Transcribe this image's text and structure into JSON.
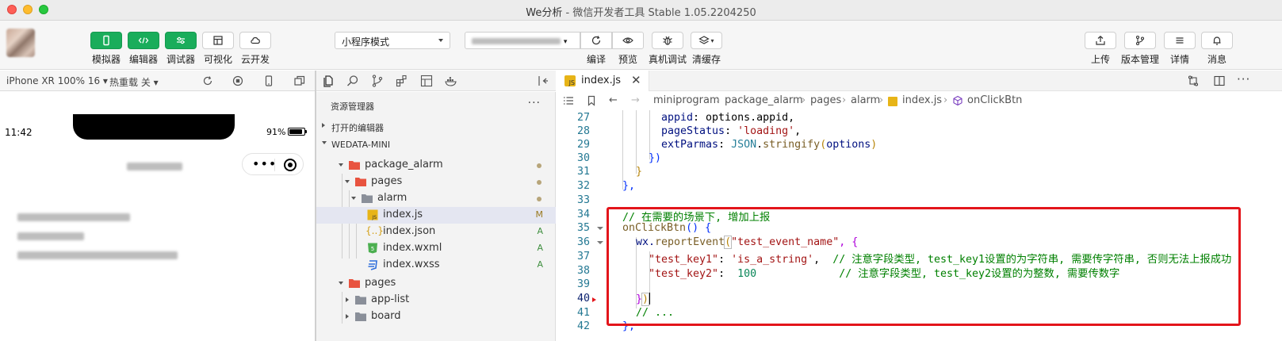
{
  "window": {
    "app_name": "We分析",
    "title_rest": " - 微信开发者工具 Stable 1.05.2204250"
  },
  "toolbar": {
    "left_buttons": [
      {
        "label": "模拟器",
        "icon": "phone-icon"
      },
      {
        "label": "编辑器",
        "icon": "code-icon"
      },
      {
        "label": "调试器",
        "icon": "sliders-icon"
      },
      {
        "label": "可视化",
        "icon": "layout-icon"
      },
      {
        "label": "云开发",
        "icon": "cloud-icon"
      }
    ],
    "mode_select": "小程序模式",
    "compile_select_suffix": "▾",
    "middle_buttons": [
      {
        "label": "编译",
        "icon": "refresh-icon"
      },
      {
        "label": "预览",
        "icon": "eye-icon"
      },
      {
        "label": "真机调试",
        "icon": "bug-icon"
      },
      {
        "label": "清缓存",
        "icon": "layers-icon"
      }
    ],
    "right_buttons": [
      {
        "label": "上传",
        "icon": "upload-icon"
      },
      {
        "label": "版本管理",
        "icon": "branch-icon"
      },
      {
        "label": "详情",
        "icon": "menu-icon"
      },
      {
        "label": "消息",
        "icon": "bell-icon"
      }
    ]
  },
  "simulator": {
    "device": "iPhone XR 100% 16 ▾",
    "hot_reload": "热重载 关 ▾",
    "time": "11:42",
    "battery": "91%",
    "capsule_dots": "•••"
  },
  "explorer": {
    "title": "资源管理器",
    "more": "···",
    "open_editors": "打开的编辑器",
    "project": "WEDATA-MINI",
    "tree": [
      {
        "name": "package_alarm",
        "type": "folder-red",
        "status": "dot",
        "depth": 1,
        "open": true
      },
      {
        "name": "pages",
        "type": "folder-red",
        "status": "dot",
        "depth": 2,
        "open": true
      },
      {
        "name": "alarm",
        "type": "folder-gray",
        "status": "dot",
        "depth": 3,
        "open": true
      },
      {
        "name": "index.js",
        "type": "js",
        "status": "M",
        "depth": 4,
        "selected": true
      },
      {
        "name": "index.json",
        "type": "json",
        "status": "A",
        "depth": 4
      },
      {
        "name": "index.wxml",
        "type": "wxml",
        "status": "A",
        "depth": 4
      },
      {
        "name": "index.wxss",
        "type": "wxss",
        "status": "A",
        "depth": 4
      },
      {
        "name": "pages",
        "type": "folder-red",
        "status": "",
        "depth": 1,
        "open": true
      },
      {
        "name": "app-list",
        "type": "folder-gray",
        "status": "",
        "depth": 2,
        "open": false
      },
      {
        "name": "board",
        "type": "folder-gray",
        "status": "",
        "depth": 2,
        "open": false
      }
    ]
  },
  "editor": {
    "tab": "index.js",
    "breadcrumb": [
      "miniprogram",
      "package_alarm",
      "pages",
      "alarm",
      "index.js",
      "onClickBtn"
    ],
    "line_numbers": [
      "27",
      "28",
      "29",
      "30",
      "31",
      "32",
      "33",
      "34",
      "35",
      "36",
      "37",
      "38",
      "39",
      "40",
      "41",
      "42"
    ],
    "code": {
      "l27_key": "appid",
      "l27_rest": ": options.appid,",
      "l28_key": "pageStatus",
      "l28_colon": ": ",
      "l28_str": "'loading'",
      "l28_comma": ",",
      "l29_key": "extParmas",
      "l29_colon": ": ",
      "l29_obj": "JSON",
      "l29_dot": ".",
      "l29_fn": "stringify",
      "l29_open": "(",
      "l29_arg": "options",
      "l29_close": ")",
      "l30": "})",
      "l31": "}",
      "l32": "},",
      "l34": "// 在需要的场景下, 增加上报",
      "l35_fn": "onClickBtn",
      "l35_paren": "()",
      "l35_brace": " {",
      "l36_pre": "wx.",
      "l36_fn": "reportEvent",
      "l36_paren": "(",
      "l36_str": "\"test_event_name\"",
      "l36_rest": ", {",
      "l37_str": "\"test_key1\"",
      "l37_colon": ": ",
      "l37_val": "'is_a_string'",
      "l37_comma": ",  ",
      "l37_com": "// 注意字段类型, test_key1设置的为字符串, 需要传字符串, 否则无法上报成功",
      "l38_str": "\"test_key2\"",
      "l38_colon": ":  ",
      "l38_val": "100",
      "l38_pad": "             ",
      "l38_com": "// 注意字段类型, test_key2设置的为整数, 需要传数字",
      "l40_brace": "}",
      "l40_paren": ")",
      "l41": "// ...",
      "l42": "},"
    }
  },
  "colors": {
    "accent_green": "#1aad5b",
    "highlight_red": "#e3151b"
  }
}
